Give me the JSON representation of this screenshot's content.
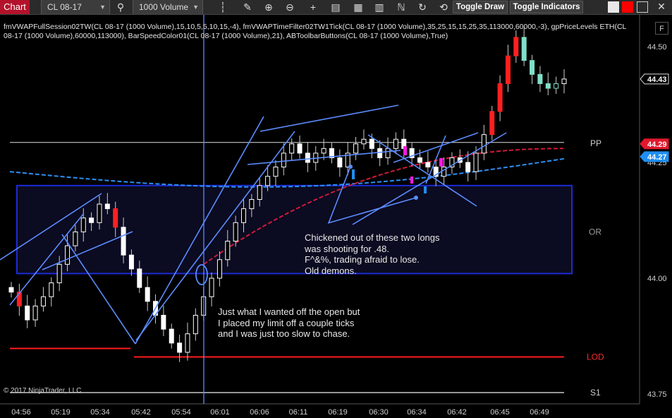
{
  "toolbar": {
    "tab_label": "Chart",
    "instrument": "CL 08-17",
    "bar_type": "1000 Volume",
    "toggle_draw_label": "Toggle Draw",
    "toggle_indicators_label": "Toggle Indicators",
    "f_button_label": "F",
    "icons": [
      "search-icon",
      "candlestick-icon",
      "pencil-icon",
      "zoom-in-icon",
      "zoom-out-icon",
      "crosshair-icon",
      "properties-icon",
      "bar-chart-icon",
      "strategy-icon",
      "cycle-icon",
      "refresh-icon"
    ]
  },
  "indicator_text": "fmVWAPFullSession02TW(CL 08-17 (1000 Volume),15,10,5,5,10,15,-4), fmVWAPTimeFilter02TW1Tick(CL 08-17 (1000 Volume),35,25,15,15,25,35,113000,60000,-3), gpPriceLevels ETH(CL 08-17 (1000 Volume),60000,113000), BarSpeedColor01(CL 08-17 (1000 Volume),21), ABToolbarButtons(CL 08-17 (1000 Volume),True)",
  "notes": {
    "note1": "Chickened out of these two longs\nwas shooting for .48.\nF^&%, trading afraid to lose.\nOld demons.",
    "note2": "Just what I wanted off the open but\nI placed my limit off a couple ticks\nand I was just too slow to chase."
  },
  "copyright": "© 2017 NinjaTrader, LLC",
  "chart_data": {
    "type": "candlestick",
    "instrument": "CL 08-17",
    "bar_type": "1000 Volume",
    "y_ticks": [
      "44.50",
      "44.25",
      "44.00",
      "43.75"
    ],
    "ylim": [
      43.75,
      44.55
    ],
    "x_ticks": [
      "04:56",
      "05:19",
      "05:34",
      "05:42",
      "05:54",
      "06:01",
      "06:06",
      "06:11",
      "06:19",
      "06:30",
      "06:34",
      "06:42",
      "06:45",
      "06:49"
    ],
    "last_price": "44.43",
    "levels": [
      {
        "label": "PP",
        "value": 44.29,
        "tag": "44.29",
        "color": "#e0182d"
      },
      {
        "label": "",
        "value": 44.27,
        "tag": "44.27",
        "color": "#1f8ef1"
      },
      {
        "label": "OR",
        "value": 44.1,
        "tag": "",
        "color": "#1a1aa0"
      },
      {
        "label": "LOD",
        "value": 43.83,
        "tag": "",
        "color": "#ff1a1a"
      },
      {
        "label": "S1",
        "value": 43.75,
        "tag": "",
        "color": "#bbbbbb"
      }
    ],
    "opening_range": {
      "high": 44.2,
      "low": 44.01
    },
    "closes": [
      43.97,
      43.94,
      43.91,
      43.94,
      43.96,
      43.99,
      44.03,
      44.07,
      44.1,
      44.13,
      44.12,
      44.16,
      44.15,
      44.11,
      44.05,
      44.02,
      43.98,
      43.95,
      43.92,
      43.89,
      43.86,
      43.84,
      43.88,
      43.92,
      43.96,
      44.0,
      44.04,
      44.08,
      44.12,
      44.15,
      44.17,
      44.2,
      44.22,
      44.24,
      44.27,
      44.29,
      44.27,
      44.25,
      44.27,
      44.28,
      44.26,
      44.24,
      44.27,
      44.29,
      44.3,
      44.28,
      44.26,
      44.28,
      44.3,
      44.28,
      44.26,
      44.25,
      44.24,
      44.22,
      44.24,
      44.26,
      44.25,
      44.23,
      44.27,
      44.31,
      44.36,
      44.42,
      44.48,
      44.52,
      44.47,
      44.44,
      44.42,
      44.41,
      44.42,
      44.43
    ]
  }
}
